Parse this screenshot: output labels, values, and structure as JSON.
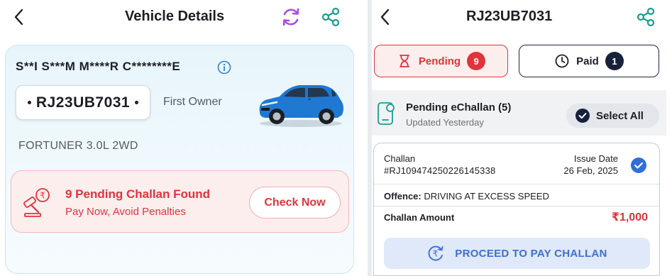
{
  "left": {
    "header": {
      "title": "Vehicle Details"
    },
    "vehicle": {
      "owner_masked": "S**I S***M M****R C********E",
      "plate": "RJ23UB7031",
      "owner_type": "First Owner",
      "model": "FORTUNER 3.0L 2WD"
    },
    "alert": {
      "title": "9 Pending Challan Found",
      "subtitle": "Pay Now, Avoid Penalties",
      "cta": "Check Now"
    }
  },
  "right": {
    "header": {
      "title": "RJ23UB7031"
    },
    "tabs": [
      {
        "label": "Pending",
        "count": "9"
      },
      {
        "label": "Paid",
        "count": "1"
      }
    ],
    "summary": {
      "title": "Pending eChallan (5)",
      "subtitle": "Updated Yesterday",
      "select_all": "Select All"
    },
    "challan": {
      "label": "Challan",
      "number": "#RJ109474250226145338",
      "issue_date_label": "Issue Date",
      "issue_date": "26 Feb, 2025",
      "offence_label": "Offence:",
      "offence": " DRIVING AT EXCESS SPEED",
      "amount_label": "Challan Amount",
      "amount": "₹1,000",
      "pay_cta": "PROCEED TO PAY CHALLAN"
    }
  },
  "colors": {
    "accent_red": "#e0343a",
    "accent_blue": "#3f6fcf",
    "refresh_purple": "#a94be6",
    "share_teal": "#1a9e8a",
    "navy": "#17213a"
  },
  "icons": [
    "back-arrow-icon",
    "refresh-icon",
    "share-icon",
    "info-icon",
    "car-image",
    "gavel-icon",
    "hourglass-icon",
    "clock-icon",
    "document-icon",
    "checkmark-icon",
    "rupee-pay-icon"
  ]
}
